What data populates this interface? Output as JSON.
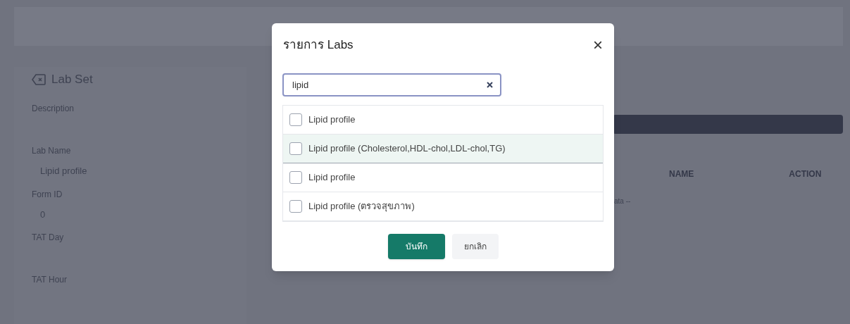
{
  "lab_set": {
    "title": "Lab Set",
    "fields": [
      {
        "label": "Description"
      },
      {
        "label": "Lab Name",
        "value": "Lipid profile"
      },
      {
        "label": "Form ID",
        "value": "0"
      },
      {
        "label": "TAT Day"
      },
      {
        "label": "TAT Hour"
      }
    ]
  },
  "table": {
    "columns": [
      "NAME",
      "ACTION"
    ],
    "empty_message": "ata --"
  },
  "modal": {
    "title": "รายการ Labs",
    "close": "×",
    "search": {
      "value": "lipid"
    },
    "items": [
      {
        "label": "Lipid profile",
        "checked": false,
        "highlighted": false
      },
      {
        "label": "Lipid profile (Cholesterol,HDL-chol,LDL-chol,TG)",
        "checked": false,
        "highlighted": true
      },
      {
        "label": "Lipid profile",
        "checked": false,
        "highlighted": false
      },
      {
        "label": "Lipid profile (ตรวจสุขภาพ)",
        "checked": false,
        "highlighted": false
      }
    ],
    "buttons": [
      {
        "label": "บันทึก",
        "kind": "primary"
      },
      {
        "label": "ยกเลิก",
        "kind": "secondary"
      }
    ]
  }
}
